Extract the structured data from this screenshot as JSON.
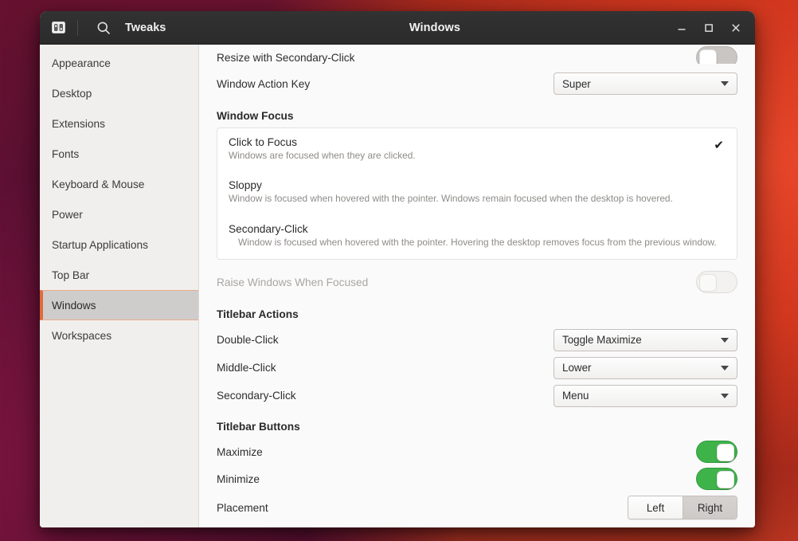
{
  "window": {
    "app_name": "Tweaks",
    "title": "Windows",
    "menu_icon": "tweaks-app-icon",
    "search_icon": "search-icon",
    "minimize_icon": "minimize-icon",
    "maximize_icon": "maximize-icon",
    "close_icon": "close-icon"
  },
  "sidebar": {
    "items": [
      {
        "label": "Appearance",
        "selected": false
      },
      {
        "label": "Desktop",
        "selected": false
      },
      {
        "label": "Extensions",
        "selected": false
      },
      {
        "label": "Fonts",
        "selected": false
      },
      {
        "label": "Keyboard & Mouse",
        "selected": false
      },
      {
        "label": "Power",
        "selected": false
      },
      {
        "label": "Startup Applications",
        "selected": false
      },
      {
        "label": "Top Bar",
        "selected": false
      },
      {
        "label": "Windows",
        "selected": true
      },
      {
        "label": "Workspaces",
        "selected": false
      }
    ]
  },
  "content": {
    "resize_secondary_click": {
      "label": "Resize with Secondary-Click",
      "toggle_state": "off"
    },
    "window_action_key": {
      "label": "Window Action Key",
      "value": "Super"
    },
    "window_focus": {
      "heading": "Window Focus",
      "options": [
        {
          "title": "Click to Focus",
          "description": "Windows are focused when they are clicked.",
          "selected": true,
          "check_icon": "checkmark-icon"
        },
        {
          "title": "Sloppy",
          "description": "Window is focused when hovered with the pointer. Windows remain focused when the desktop is hovered.",
          "selected": false
        },
        {
          "title": "Secondary-Click",
          "description": "Window is focused when hovered with the pointer. Hovering the desktop removes focus from the previous window.",
          "selected": false
        }
      ]
    },
    "raise_windows": {
      "label": "Raise Windows When Focused",
      "toggle_state": "off",
      "disabled": true
    },
    "titlebar_actions": {
      "heading": "Titlebar Actions",
      "rows": [
        {
          "label": "Double-Click",
          "value": "Toggle Maximize"
        },
        {
          "label": "Middle-Click",
          "value": "Lower"
        },
        {
          "label": "Secondary-Click",
          "value": "Menu"
        }
      ]
    },
    "titlebar_buttons": {
      "heading": "Titlebar Buttons",
      "maximize": {
        "label": "Maximize",
        "toggle_state": "on"
      },
      "minimize": {
        "label": "Minimize",
        "toggle_state": "on"
      },
      "placement": {
        "label": "Placement",
        "options": [
          "Left",
          "Right"
        ],
        "selected": "Right"
      }
    }
  },
  "colors": {
    "accent_green": "#3eb34a",
    "selection_orange": "#e06a3d",
    "headerbar": "#2b2b2b"
  }
}
